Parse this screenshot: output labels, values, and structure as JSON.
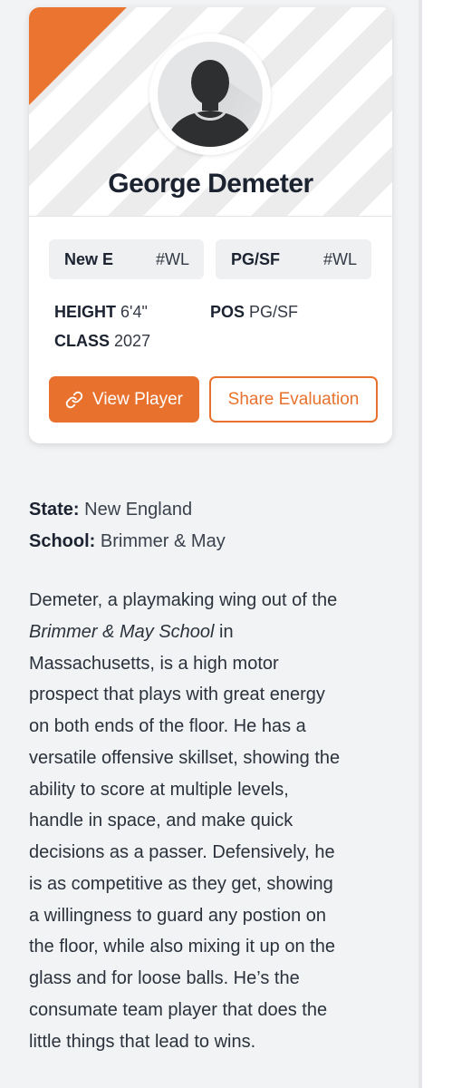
{
  "card": {
    "name": "George Demeter",
    "chips": [
      {
        "main": "New E",
        "tag": "#WL"
      },
      {
        "main": "PG/SF",
        "tag": "#WL"
      }
    ],
    "stats": {
      "height_label": "HEIGHT",
      "height_value": "6'4\"",
      "pos_label": "POS",
      "pos_value": "PG/SF",
      "class_label": "CLASS",
      "class_value": "2027"
    },
    "buttons": {
      "view_player": "View Player",
      "share_evaluation": "Share Evaluation"
    },
    "icons": {
      "avatar": "person-silhouette-icon",
      "view_player": "link-icon"
    },
    "colors": {
      "accent": "#e8722d"
    }
  },
  "meta": {
    "state_label": "State:",
    "state_value": "New England",
    "school_label": "School:",
    "school_value": "Brimmer & May"
  },
  "bio": {
    "lines": [
      "Demeter, a playmaking wing out of the",
      "Brimmer & May School",
      " in",
      "Massachusetts, is a high motor",
      "prospect that plays with great energy",
      "on both ends of the floor. He has a",
      "versatile offensive skillset, showing the",
      "ability to score at multiple levels,",
      "handle in space, and make quick",
      "decisions as a passer. Defensively, he",
      "is as competitive as they get, showing",
      "a willingness to guard any postion on",
      "the floor, while also mixing it up on the",
      "glass and for loose balls. He’s the",
      "consumate team player that does the",
      "little things that lead to wins."
    ]
  }
}
